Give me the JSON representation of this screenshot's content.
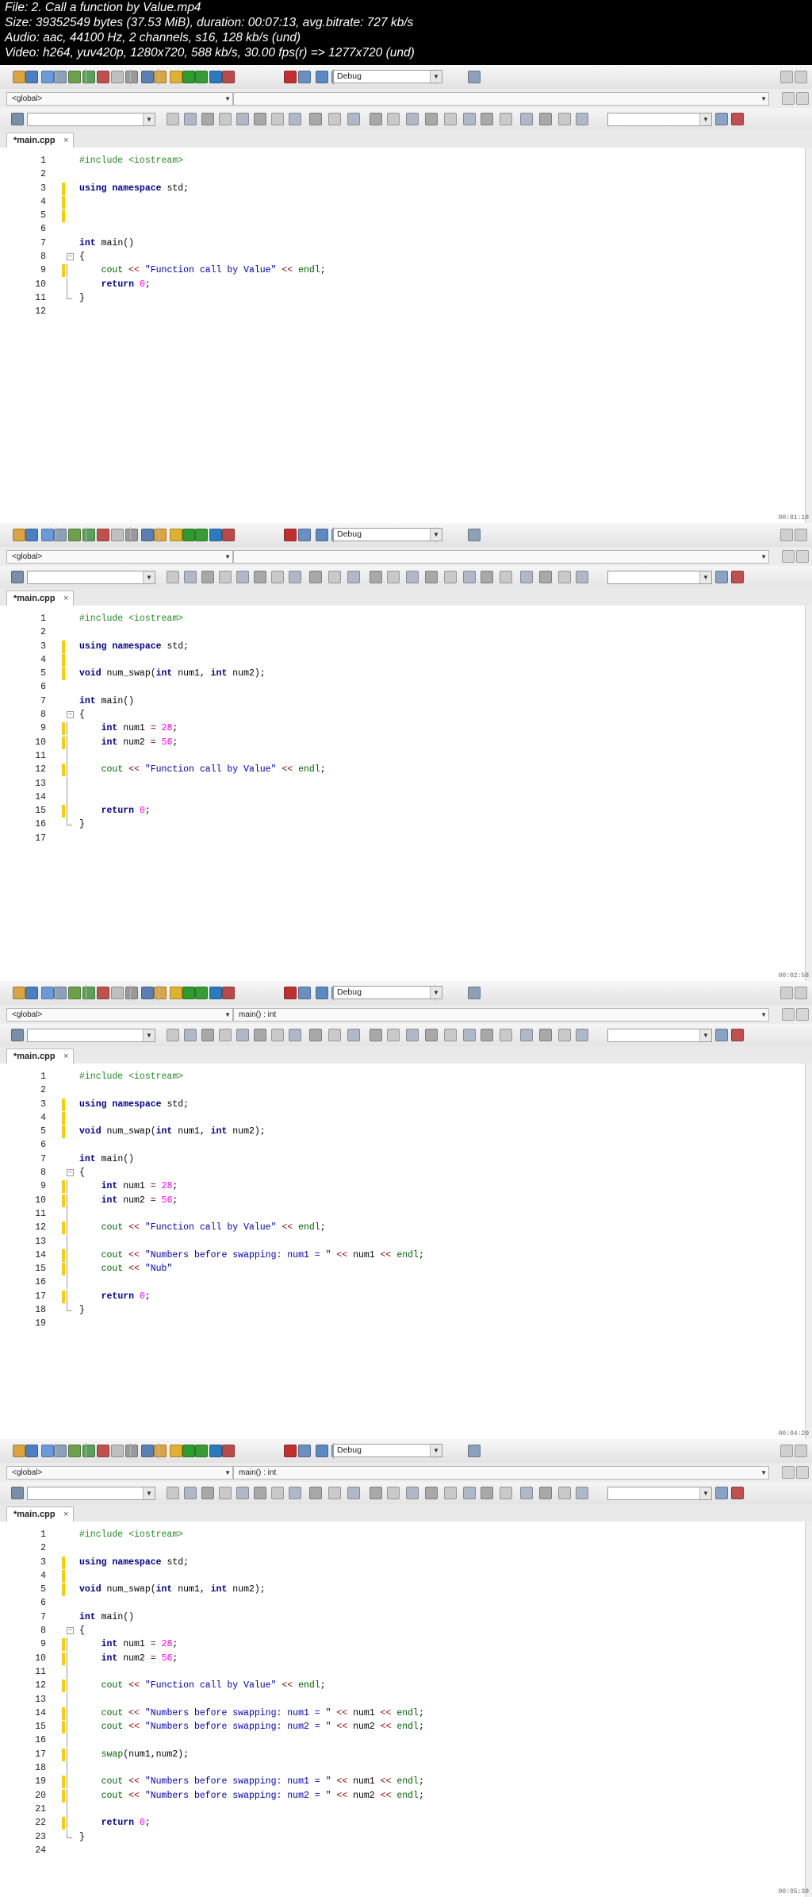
{
  "header": {
    "line1": "File: 2. Call a function by Value.mp4",
    "line2": "Size: 39352549 bytes (37.53 MiB), duration: 00:07:13, avg.bitrate: 727 kb/s",
    "line3": "Audio: aac, 44100 Hz, 2 channels, s16, 128 kb/s (und)",
    "line4": "Video: h264, yuv420p, 1280x720, 588 kb/s, 30.00 fps(r) => 1277x720 (und)"
  },
  "ide": {
    "build_target": "Debug",
    "scope_global": "<global>",
    "file_tab": "*main.cpp",
    "tab_close": "×"
  },
  "colors": {
    "keyword": "#00008b",
    "preprocessor": "#228b22",
    "string": "#0000b0",
    "number": "#ff00ff",
    "changed_marker": "#f5d000"
  },
  "frames": [
    {
      "timestamp": "00:01:18",
      "symbol_scope": "",
      "lines": [
        "#include <iostream>",
        "",
        "using namespace std;",
        "",
        "",
        "",
        "int main()",
        "{",
        "    cout << \"Function call by Value\" << endl;",
        "    return 0;",
        "}",
        ""
      ]
    },
    {
      "timestamp": "00:02:58",
      "symbol_scope": "",
      "lines": [
        "#include <iostream>",
        "",
        "using namespace std;",
        "",
        "void num_swap(int num1, int num2);",
        "",
        "int main()",
        "{",
        "    int num1 = 28;",
        "    int num2 = 56;",
        "",
        "    cout << \"Function call by Value\" << endl;",
        "",
        "",
        "    return 0;",
        "}",
        ""
      ]
    },
    {
      "timestamp": "00:04:20",
      "symbol_scope": "main() : int",
      "lines": [
        "#include <iostream>",
        "",
        "using namespace std;",
        "",
        "void num_swap(int num1, int num2);",
        "",
        "int main()",
        "{",
        "    int num1 = 28;",
        "    int num2 = 56;",
        "",
        "    cout << \"Function call by Value\" << endl;",
        "",
        "    cout << \"Numbers before swapping: num1 = \" << num1 << endl;",
        "    cout << \"Nub\"",
        "",
        "    return 0;",
        "}",
        ""
      ]
    },
    {
      "timestamp": "00:05:39",
      "symbol_scope": "main() : int",
      "lines": [
        "#include <iostream>",
        "",
        "using namespace std;",
        "",
        "void num_swap(int num1, int num2);",
        "",
        "int main()",
        "{",
        "    int num1 = 28;",
        "    int num2 = 56;",
        "",
        "    cout << \"Function call by Value\" << endl;",
        "",
        "    cout << \"Numbers before swapping: num1 = \" << num1 << endl;",
        "    cout << \"Numbers before swapping: num2 = \" << num2 << endl;",
        "",
        "    swap(num1,num2);",
        "",
        "    cout << \"Numbers before swapping: num1 = \" << num1 << endl;",
        "    cout << \"Numbers before swapping: num2 = \" << num2 << endl;",
        "",
        "    return 0;",
        "}",
        ""
      ]
    }
  ]
}
